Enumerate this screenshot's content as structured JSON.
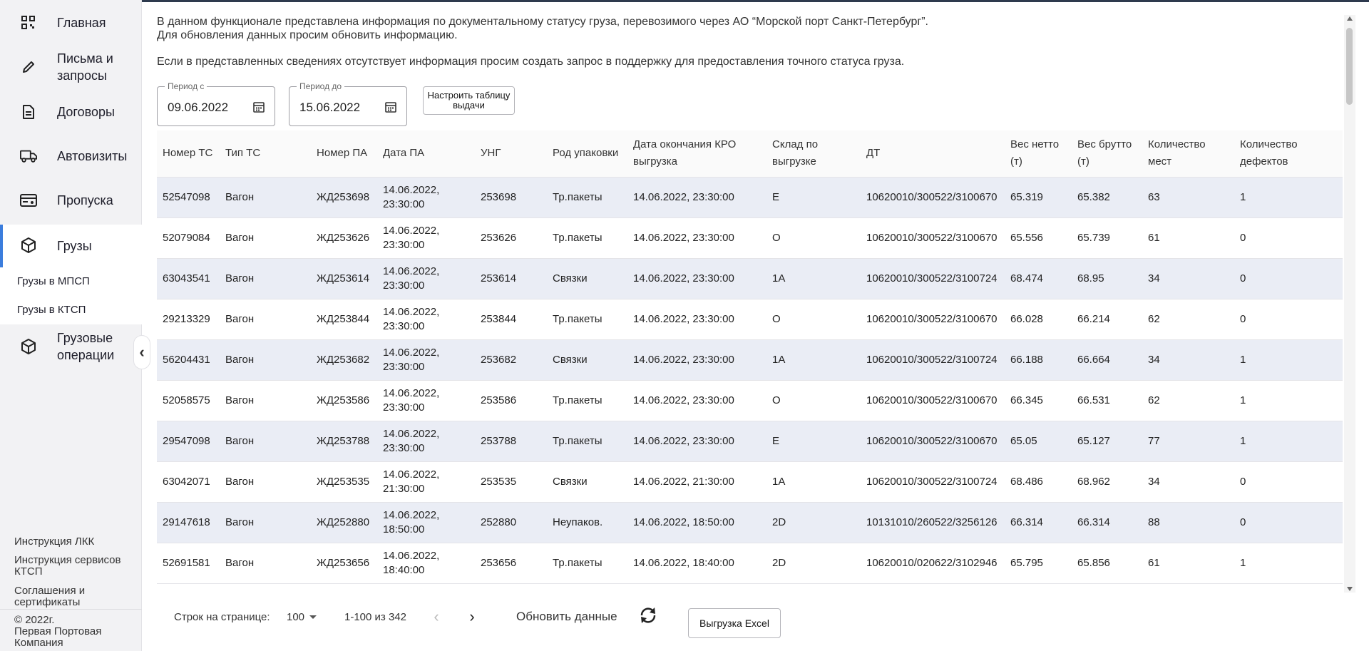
{
  "sidebar": {
    "items": [
      {
        "label": "Главная",
        "icon": "dashboard-grid-icon"
      },
      {
        "label": "Письма и запросы",
        "icon": "pencil-icon"
      },
      {
        "label": "Договоры",
        "icon": "document-icon"
      },
      {
        "label": "Автовизиты",
        "icon": "truck-icon"
      },
      {
        "label": "Пропуска",
        "icon": "pass-card-icon"
      },
      {
        "label": "Грузы",
        "icon": "cargo-box-icon",
        "active": true
      },
      {
        "label": "Грузовые операции",
        "icon": "cargo-operations-icon"
      }
    ],
    "subitems": [
      "Грузы в МПСП",
      "Грузы в КТСП"
    ],
    "footer_links": [
      "Инструкция ЛКК",
      "Инструкция сервисов КТСП",
      "Соглашения и сертификаты"
    ],
    "copyright_lines": [
      "© 2022г.",
      "Первая Портовая",
      "Компания"
    ],
    "collapse_glyph": "‹"
  },
  "info": {
    "line1": "В данном функционале представлена информация по документальному статусу груза, перевозимого через АО “Морской порт Санкт-Петербург”.",
    "line2": "Для обновления данных просим обновить информацию.",
    "line3": "Если в представленных сведениях отсутствует информация просим создать запрос в поддержку для предоставления точного статуса груза."
  },
  "filters": {
    "from_label": "Период с",
    "from_value": "09.06.2022",
    "to_label": "Период до",
    "to_value": "15.06.2022",
    "setup_button": "Настроить таблицу выдачи"
  },
  "table": {
    "columns": [
      "Номер ТС",
      "Тип ТС",
      "Номер ПА",
      "Дата ПА",
      "УНГ",
      "Род упаковки",
      "Дата окончания КРО выгрузка",
      "Склад по выгрузке",
      "ДТ",
      "Вес нетто (т)",
      "Вес брутто (т)",
      "Количество мест",
      "Количество дефектов"
    ],
    "rows": [
      [
        "52547098",
        "Вагон",
        "ЖД253698",
        "14.06.2022, 23:30:00",
        "253698",
        "Тр.пакеты",
        "14.06.2022, 23:30:00",
        "E",
        "10620010/300522/3100670",
        "65.319",
        "65.382",
        "63",
        "1"
      ],
      [
        "52079084",
        "Вагон",
        "ЖД253626",
        "14.06.2022, 23:30:00",
        "253626",
        "Тр.пакеты",
        "14.06.2022, 23:30:00",
        "O",
        "10620010/300522/3100670",
        "65.556",
        "65.739",
        "61",
        "0"
      ],
      [
        "63043541",
        "Вагон",
        "ЖД253614",
        "14.06.2022, 23:30:00",
        "253614",
        "Связки",
        "14.06.2022, 23:30:00",
        "1A",
        "10620010/300522/3100724",
        "68.474",
        "68.95",
        "34",
        "0"
      ],
      [
        "29213329",
        "Вагон",
        "ЖД253844",
        "14.06.2022, 23:30:00",
        "253844",
        "Тр.пакеты",
        "14.06.2022, 23:30:00",
        "O",
        "10620010/300522/3100670",
        "66.028",
        "66.214",
        "62",
        "0"
      ],
      [
        "56204431",
        "Вагон",
        "ЖД253682",
        "14.06.2022, 23:30:00",
        "253682",
        "Связки",
        "14.06.2022, 23:30:00",
        "1A",
        "10620010/300522/3100724",
        "66.188",
        "66.664",
        "34",
        "1"
      ],
      [
        "52058575",
        "Вагон",
        "ЖД253586",
        "14.06.2022, 23:30:00",
        "253586",
        "Тр.пакеты",
        "14.06.2022, 23:30:00",
        "O",
        "10620010/300522/3100670",
        "66.345",
        "66.531",
        "62",
        "1"
      ],
      [
        "29547098",
        "Вагон",
        "ЖД253788",
        "14.06.2022, 23:30:00",
        "253788",
        "Тр.пакеты",
        "14.06.2022, 23:30:00",
        "E",
        "10620010/300522/3100670",
        "65.05",
        "65.127",
        "77",
        "1"
      ],
      [
        "63042071",
        "Вагон",
        "ЖД253535",
        "14.06.2022, 21:30:00",
        "253535",
        "Связки",
        "14.06.2022, 21:30:00",
        "1A",
        "10620010/300522/3100724",
        "68.486",
        "68.962",
        "34",
        "0"
      ],
      [
        "29147618",
        "Вагон",
        "ЖД252880",
        "14.06.2022, 18:50:00",
        "252880",
        "Неупаков.",
        "14.06.2022, 18:50:00",
        "2D",
        "10131010/260522/3256126",
        "66.314",
        "66.314",
        "88",
        "0"
      ],
      [
        "52691581",
        "Вагон",
        "ЖД253656",
        "14.06.2022, 18:40:00",
        "253656",
        "Тр.пакеты",
        "14.06.2022, 18:40:00",
        "2D",
        "10620010/020622/3102946",
        "65.795",
        "65.856",
        "61",
        "1"
      ]
    ]
  },
  "pagination": {
    "rows_per_page_label": "Строк на странице:",
    "rows_per_page_value": "100",
    "range_text": "1-100 из 342",
    "prev_glyph": "‹",
    "next_glyph": "›",
    "refresh_label": "Обновить данные",
    "excel_button": "Выгрузка Excel"
  },
  "colors": {
    "accent": "#3b7ddd",
    "row_stripe": "#eaedf5",
    "sidebar_bg": "#f2f2f4",
    "top_border": "#2e3a4e"
  }
}
